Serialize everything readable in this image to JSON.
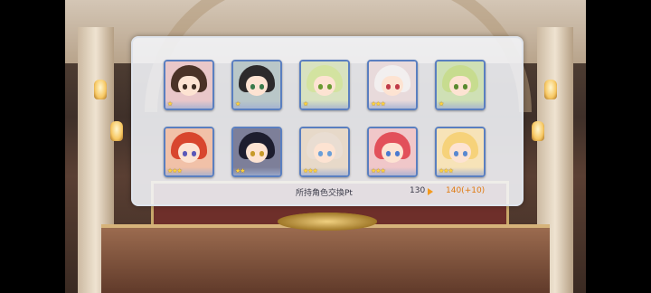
{
  "panel": {
    "characters": [
      {
        "name_icon": "character-portrait-icon",
        "stars": "★",
        "hair": "#4a3227",
        "eye": "#3b2a20",
        "bg": "#e9c7c9"
      },
      {
        "name_icon": "character-portrait-icon",
        "stars": "★",
        "hair": "#2c2a2b",
        "eye": "#3a7a4a",
        "bg": "#b9c7c8"
      },
      {
        "name_icon": "character-portrait-icon",
        "stars": "★",
        "hair": "#d3e3a0",
        "eye": "#6a9a30",
        "bg": "#d8e2c0"
      },
      {
        "name_icon": "character-portrait-icon",
        "stars": "★★★",
        "hair": "#f2efef",
        "eye": "#c03a48",
        "bg": "#e8dadb"
      },
      {
        "name_icon": "character-portrait-icon",
        "stars": "★",
        "hair": "#c7dc8f",
        "eye": "#5a8a30",
        "bg": "#cfe0b5"
      },
      {
        "name_icon": "character-portrait-icon",
        "stars": "★★★",
        "hair": "#d8462e",
        "eye": "#5a58b8",
        "bg": "#f1c1a8"
      },
      {
        "name_icon": "character-portrait-icon",
        "stars": "★★",
        "hair": "#1d1d2e",
        "eye": "#c79a2a",
        "bg": "#7d7f99"
      },
      {
        "name_icon": "character-portrait-icon",
        "stars": "★★★",
        "hair": "#e9ddd2",
        "eye": "#6a9ed8",
        "bg": "#e7d9c9"
      },
      {
        "name_icon": "character-portrait-icon",
        "stars": "★★★",
        "hair": "#e2505a",
        "eye": "#4b7ad0",
        "bg": "#f0c7c9"
      },
      {
        "name_icon": "character-portrait-icon",
        "stars": "★★★",
        "hair": "#f6d27a",
        "eye": "#5a88d0",
        "bg": "#f7e3b8"
      }
    ],
    "pt_label": "所持角色交換Pt",
    "pt_current": "130",
    "pt_after": "140(+10)"
  },
  "colors": {
    "card_border": "#5a7fc0",
    "accent_orange": "#e07a10",
    "star_gold": "#ffd23c"
  }
}
